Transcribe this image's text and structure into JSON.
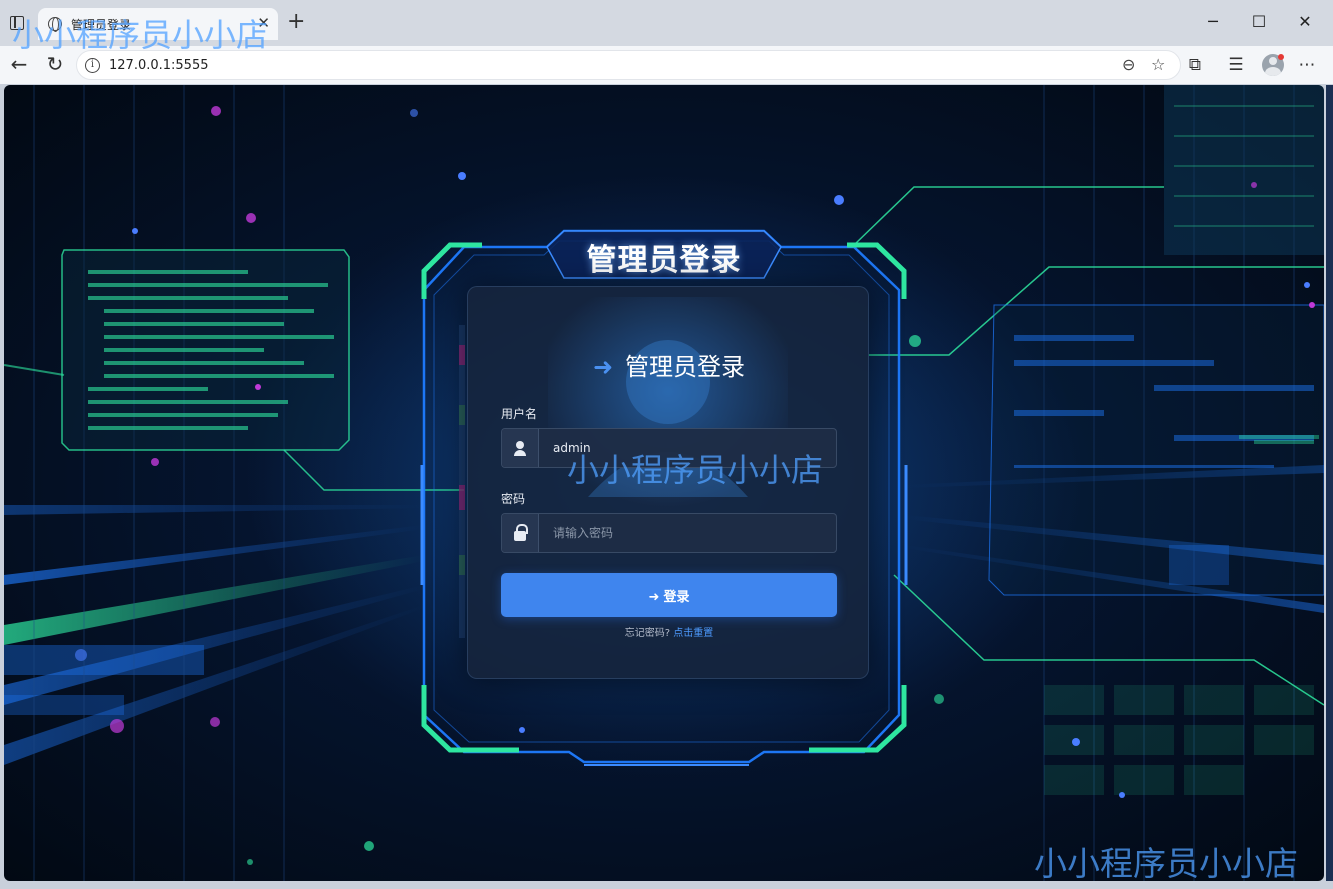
{
  "browser": {
    "tab_title": "管理员登录",
    "tab_close": "✕",
    "new_tab": "+",
    "minimize": "─",
    "maximize": "☐",
    "close": "✕",
    "back": "←",
    "reload": "↻",
    "url": "127.0.0.1:5555",
    "info_glyph": "i",
    "zoom_glyph": "⊖",
    "favorite_glyph": "☆",
    "extensions_glyph": "⧉",
    "favorites_list_glyph": "☰",
    "more_glyph": "⋯"
  },
  "page": {
    "frame_title": "管理员登录",
    "card_heading": "管理员登录",
    "login_icon_glyph": "➜",
    "username_label": "用户名",
    "username_value": "admin",
    "password_label": "密码",
    "password_placeholder": "请输入密码",
    "login_button_label": "登录",
    "login_button_icon": "➜",
    "forgot_text": "忘记密码?",
    "reset_link": "点击重置"
  },
  "watermarks": {
    "top_left": "小小程序员小小店",
    "center": "小小程序员小小店",
    "bottom_right": "小小程序员小小店"
  },
  "colors": {
    "accent_blue": "#3f85ee",
    "frame_green": "#2ee6a0",
    "frame_blue": "#1f7bff",
    "watermark": "#50a0ff"
  }
}
